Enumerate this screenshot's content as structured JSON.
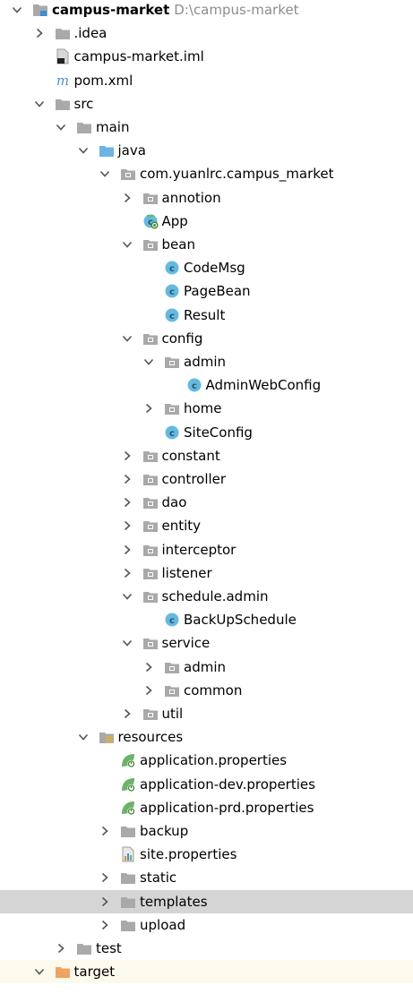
{
  "tree": [
    {
      "label": "campus-market",
      "path": "D:\\campus-market",
      "depth": 0,
      "expanded": true,
      "icon": "module-icon",
      "bold": true
    },
    {
      "label": ".idea",
      "depth": 1,
      "expanded": false,
      "icon": "folder-icon"
    },
    {
      "label": "campus-market.iml",
      "depth": 1,
      "leaf": true,
      "icon": "iml-file-icon"
    },
    {
      "label": "pom.xml",
      "depth": 1,
      "leaf": true,
      "icon": "maven-icon"
    },
    {
      "label": "src",
      "depth": 1,
      "expanded": true,
      "icon": "folder-icon"
    },
    {
      "label": "main",
      "depth": 2,
      "expanded": true,
      "icon": "folder-icon"
    },
    {
      "label": "java",
      "depth": 3,
      "expanded": true,
      "icon": "source-folder-icon"
    },
    {
      "label": "com.yuanlrc.campus_market",
      "depth": 4,
      "expanded": true,
      "icon": "package-icon"
    },
    {
      "label": "annotion",
      "depth": 5,
      "expanded": false,
      "icon": "package-icon"
    },
    {
      "label": "App",
      "depth": 5,
      "leaf": true,
      "icon": "spring-boot-class-icon"
    },
    {
      "label": "bean",
      "depth": 5,
      "expanded": true,
      "icon": "package-icon"
    },
    {
      "label": "CodeMsg",
      "depth": 6,
      "leaf": true,
      "icon": "class-icon"
    },
    {
      "label": "PageBean",
      "depth": 6,
      "leaf": true,
      "icon": "class-icon"
    },
    {
      "label": "Result",
      "depth": 6,
      "leaf": true,
      "icon": "class-icon"
    },
    {
      "label": "config",
      "depth": 5,
      "expanded": true,
      "icon": "package-icon"
    },
    {
      "label": "admin",
      "depth": 6,
      "expanded": true,
      "icon": "package-icon"
    },
    {
      "label": "AdminWebConfig",
      "depth": 7,
      "leaf": true,
      "icon": "class-icon"
    },
    {
      "label": "home",
      "depth": 6,
      "expanded": false,
      "icon": "package-icon"
    },
    {
      "label": "SiteConfig",
      "depth": 6,
      "leaf": true,
      "icon": "class-icon"
    },
    {
      "label": "constant",
      "depth": 5,
      "expanded": false,
      "icon": "package-icon"
    },
    {
      "label": "controller",
      "depth": 5,
      "expanded": false,
      "icon": "package-icon"
    },
    {
      "label": "dao",
      "depth": 5,
      "expanded": false,
      "icon": "package-icon"
    },
    {
      "label": "entity",
      "depth": 5,
      "expanded": false,
      "icon": "package-icon"
    },
    {
      "label": "interceptor",
      "depth": 5,
      "expanded": false,
      "icon": "package-icon"
    },
    {
      "label": "listener",
      "depth": 5,
      "expanded": false,
      "icon": "package-icon"
    },
    {
      "label": "schedule.admin",
      "depth": 5,
      "expanded": true,
      "icon": "package-icon"
    },
    {
      "label": "BackUpSchedule",
      "depth": 6,
      "leaf": true,
      "icon": "class-icon"
    },
    {
      "label": "service",
      "depth": 5,
      "expanded": true,
      "icon": "package-icon"
    },
    {
      "label": "admin",
      "depth": 6,
      "expanded": false,
      "icon": "package-icon"
    },
    {
      "label": "common",
      "depth": 6,
      "expanded": false,
      "icon": "package-icon"
    },
    {
      "label": "util",
      "depth": 5,
      "expanded": false,
      "icon": "package-icon"
    },
    {
      "label": "resources",
      "depth": 3,
      "expanded": true,
      "icon": "resources-folder-icon"
    },
    {
      "label": "application.properties",
      "depth": 4,
      "leaf": true,
      "icon": "spring-properties-icon"
    },
    {
      "label": "application-dev.properties",
      "depth": 4,
      "leaf": true,
      "icon": "spring-properties-icon"
    },
    {
      "label": "application-prd.properties",
      "depth": 4,
      "leaf": true,
      "icon": "spring-properties-icon"
    },
    {
      "label": "backup",
      "depth": 4,
      "expanded": false,
      "icon": "folder-icon"
    },
    {
      "label": "site.properties",
      "depth": 4,
      "leaf": true,
      "icon": "properties-file-icon"
    },
    {
      "label": "static",
      "depth": 4,
      "expanded": false,
      "icon": "folder-icon"
    },
    {
      "label": "templates",
      "depth": 4,
      "expanded": false,
      "icon": "folder-icon",
      "selected": true
    },
    {
      "label": "upload",
      "depth": 4,
      "expanded": false,
      "icon": "folder-icon"
    },
    {
      "label": "test",
      "depth": 2,
      "expanded": false,
      "icon": "folder-icon"
    },
    {
      "label": "target",
      "depth": 1,
      "expanded": true,
      "icon": "excluded-folder-icon",
      "excluded": true
    }
  ],
  "colors": {
    "selection": "#d5d5d5",
    "excluded_bg": "#fcfaed",
    "folder": "#a9a9a9",
    "source_folder": "#6cb4e4",
    "excluded_folder": "#f0a461",
    "class_icon": "#65b9e0",
    "spring": "#6cb36a",
    "path_text": "#8c8c8c"
  }
}
